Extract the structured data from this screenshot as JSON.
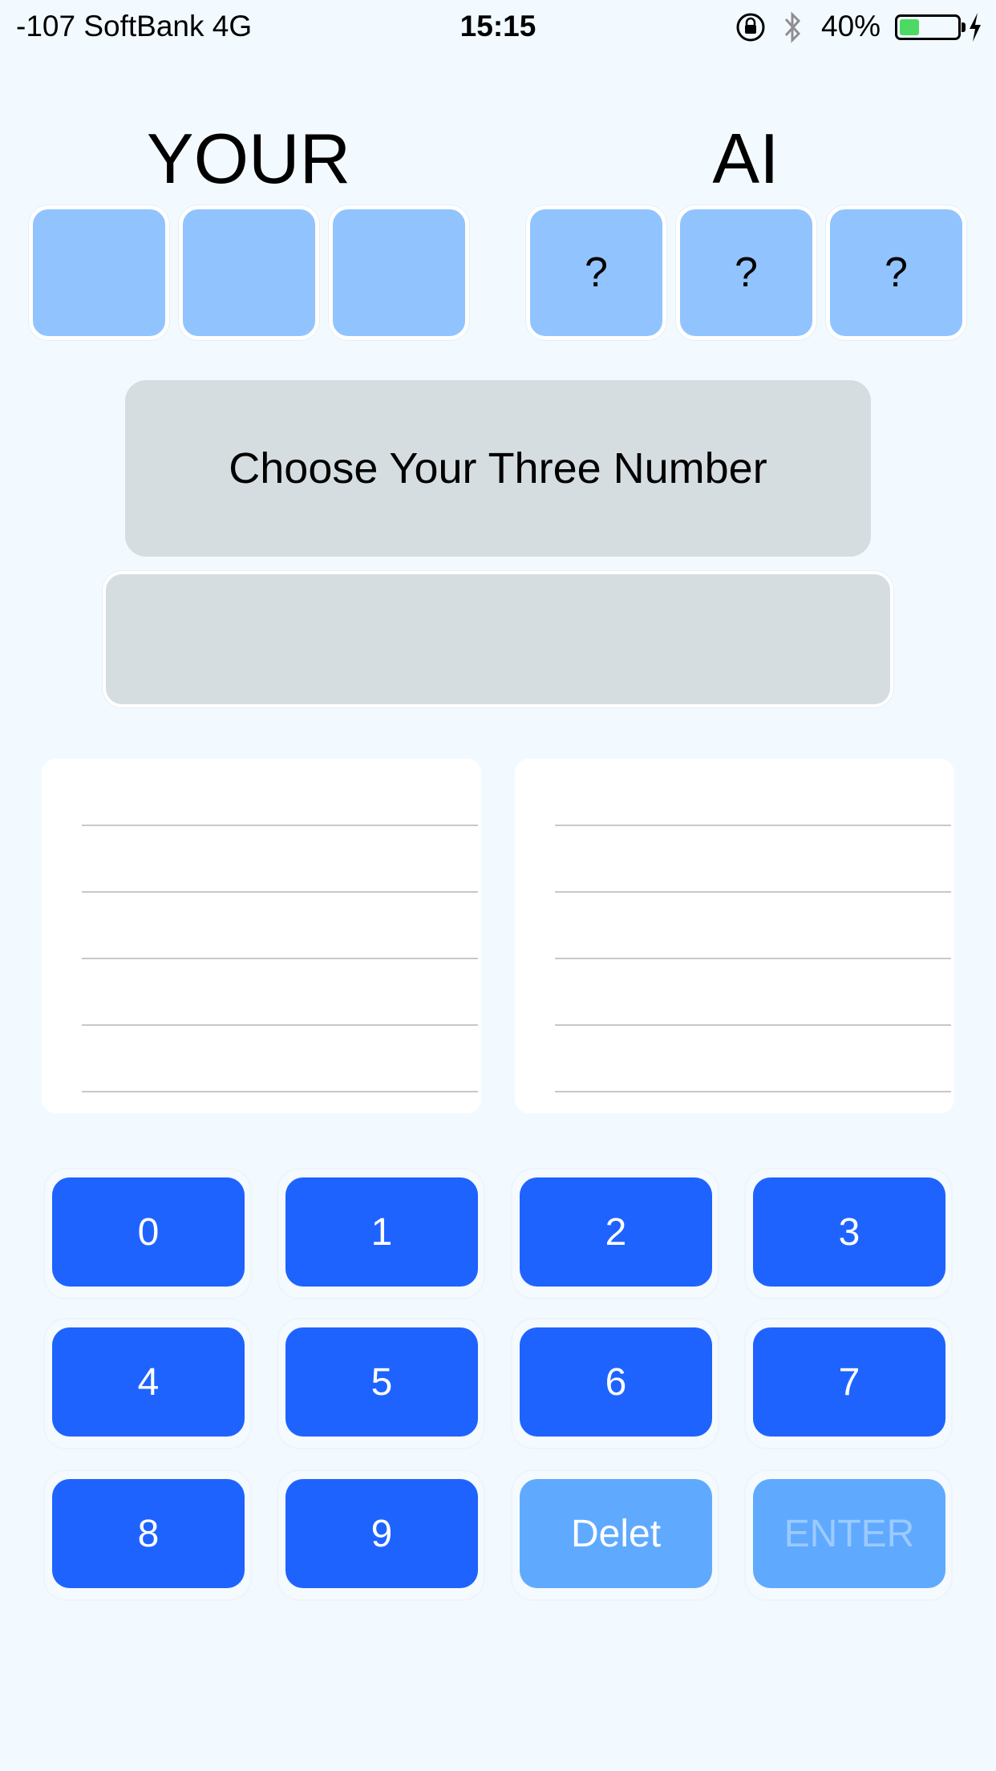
{
  "status_bar": {
    "carrier": "-107 SoftBank   4G",
    "time": "15:15",
    "battery_percent": "40%",
    "battery_level": 0.4,
    "icons": [
      "orientation-lock-icon",
      "bluetooth-icon",
      "battery-icon",
      "charging-icon"
    ]
  },
  "players": {
    "your_label": "YOUR",
    "ai_label": "AI",
    "your_digits": [
      "",
      "",
      ""
    ],
    "ai_digits": [
      "?",
      "?",
      "?"
    ]
  },
  "message": "Choose Your Three Number",
  "input_display": "",
  "history": {
    "your_rows": [
      "",
      "",
      "",
      "",
      ""
    ],
    "ai_rows": [
      "",
      "",
      "",
      "",
      ""
    ]
  },
  "keypad": {
    "keys": [
      "0",
      "1",
      "2",
      "3",
      "4",
      "5",
      "6",
      "7",
      "8",
      "9"
    ],
    "delete_label": "Delet",
    "enter_label": "ENTER"
  },
  "colors": {
    "background": "#f3faff",
    "digit_box": "#91c4ff",
    "key_active": "#1f63ff",
    "key_light": "#5faaff",
    "panel_gray": "#d5dde0"
  }
}
